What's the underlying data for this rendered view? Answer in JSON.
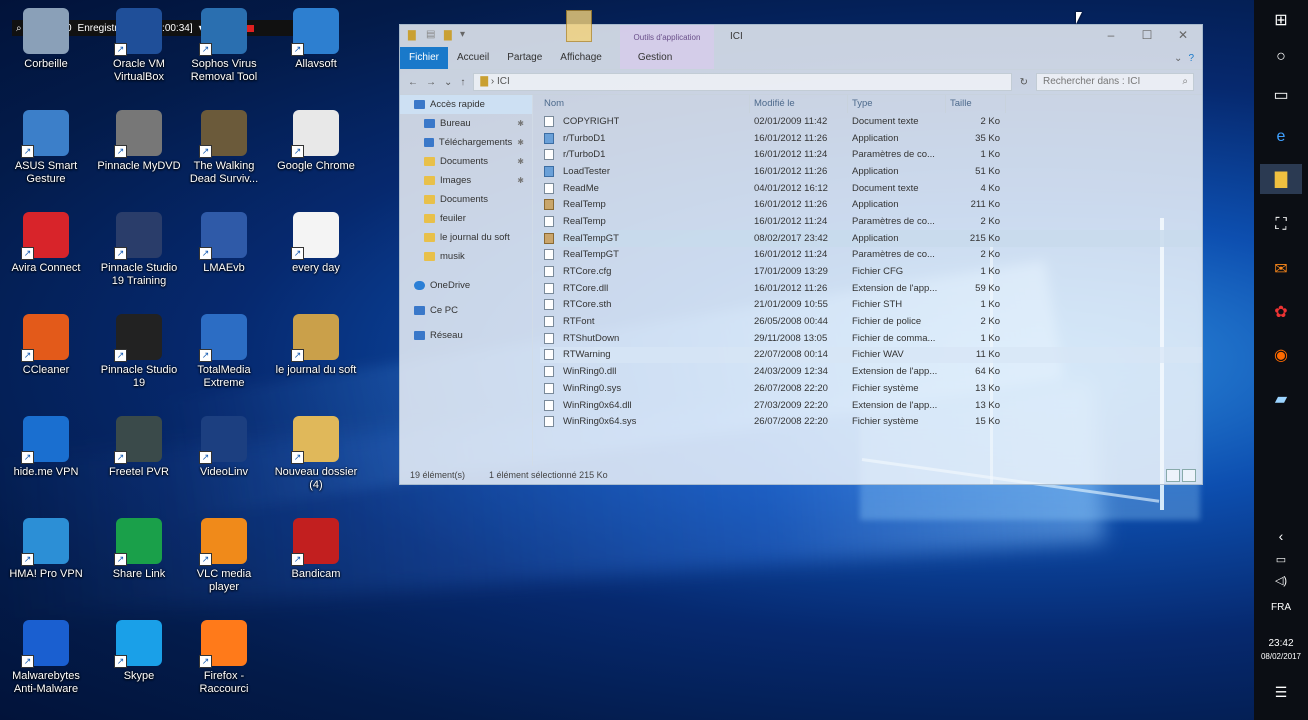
{
  "recorder": {
    "resolution": "1308x720",
    "status": "Enregistrement [00:00:34]"
  },
  "desktop": {
    "icons": [
      {
        "label": "Corbeille"
      },
      {
        "label": "Oracle VM VirtualBox"
      },
      {
        "label": "Sophos Virus Removal Tool"
      },
      {
        "label": "Allavsoft"
      },
      {
        "label": "ASUS Smart Gesture"
      },
      {
        "label": "Pinnacle MyDVD"
      },
      {
        "label": "The Walking Dead Surviv..."
      },
      {
        "label": "Google Chrome"
      },
      {
        "label": "Avira Connect"
      },
      {
        "label": "Pinnacle Studio 19 Training"
      },
      {
        "label": "LMAEvb"
      },
      {
        "label": "every day"
      },
      {
        "label": "CCleaner"
      },
      {
        "label": "Pinnacle Studio 19"
      },
      {
        "label": "TotalMedia Extreme"
      },
      {
        "label": "le journal du soft"
      },
      {
        "label": "hide.me VPN"
      },
      {
        "label": "Freetel PVR"
      },
      {
        "label": "VideoLinv"
      },
      {
        "label": "Nouveau dossier (4)"
      },
      {
        "label": "HMA! Pro VPN"
      },
      {
        "label": "Share Link"
      },
      {
        "label": "VLC media player"
      },
      {
        "label": "Bandicam"
      },
      {
        "label": "Malwarebytes Anti-Malware"
      },
      {
        "label": "Skype"
      },
      {
        "label": "Firefox - Raccourci"
      }
    ]
  },
  "explorer": {
    "title": "ICI",
    "context_tab": "Outils d'application",
    "ribbon_tabs": [
      "Fichier",
      "Accueil",
      "Partage",
      "Affichage",
      "Gestion"
    ],
    "path_folder": "ICI",
    "search_placeholder": "Rechercher dans : ICI",
    "nav": [
      {
        "label": "Accès rapide",
        "pin": ""
      },
      {
        "label": "Bureau",
        "pin": "✱"
      },
      {
        "label": "Téléchargements",
        "pin": "✱"
      },
      {
        "label": "Documents",
        "pin": "✱"
      },
      {
        "label": "Images",
        "pin": "✱"
      },
      {
        "label": "Documents",
        "pin": ""
      },
      {
        "label": "feuiler",
        "pin": ""
      },
      {
        "label": "le journal du soft",
        "pin": ""
      },
      {
        "label": "musik",
        "pin": ""
      },
      {
        "label": "OneDrive",
        "pin": ""
      },
      {
        "label": "Ce PC",
        "pin": ""
      },
      {
        "label": "Réseau",
        "pin": ""
      }
    ],
    "columns": {
      "name": "Nom",
      "date": "Modifié le",
      "type": "Type",
      "size": "Taille"
    },
    "files": [
      {
        "name": "COPYRIGHT",
        "date": "02/01/2009 11:42",
        "type": "Document texte",
        "size": "2 Ko"
      },
      {
        "name": "r/TurboD1",
        "date": "16/01/2012 11:26",
        "type": "Application",
        "size": "35 Ko"
      },
      {
        "name": "r/TurboD1",
        "date": "16/01/2012 11:24",
        "type": "Paramètres de co...",
        "size": "1 Ko"
      },
      {
        "name": "LoadTester",
        "date": "16/01/2012 11:26",
        "type": "Application",
        "size": "51 Ko"
      },
      {
        "name": "ReadMe",
        "date": "04/01/2012 16:12",
        "type": "Document texte",
        "size": "4 Ko"
      },
      {
        "name": "RealTemp",
        "date": "16/01/2012 11:26",
        "type": "Application",
        "size": "211 Ko"
      },
      {
        "name": "RealTemp",
        "date": "16/01/2012 11:24",
        "type": "Paramètres de co...",
        "size": "2 Ko"
      },
      {
        "name": "RealTempGT",
        "date": "08/02/2017 23:42",
        "type": "Application",
        "size": "215 Ko"
      },
      {
        "name": "RealTempGT",
        "date": "16/01/2012 11:24",
        "type": "Paramètres de co...",
        "size": "2 Ko"
      },
      {
        "name": "RTCore.cfg",
        "date": "17/01/2009 13:29",
        "type": "Fichier CFG",
        "size": "1 Ko"
      },
      {
        "name": "RTCore.dll",
        "date": "16/01/2012 11:26",
        "type": "Extension de l'app...",
        "size": "59 Ko"
      },
      {
        "name": "RTCore.sth",
        "date": "21/01/2009 10:55",
        "type": "Fichier STH",
        "size": "1 Ko"
      },
      {
        "name": "RTFont",
        "date": "26/05/2008 00:44",
        "type": "Fichier de police",
        "size": "2 Ko"
      },
      {
        "name": "RTShutDown",
        "date": "29/11/2008 13:05",
        "type": "Fichier de comma...",
        "size": "1 Ko"
      },
      {
        "name": "RTWarning",
        "date": "22/07/2008 00:14",
        "type": "Fichier WAV",
        "size": "11 Ko"
      },
      {
        "name": "WinRing0.dll",
        "date": "24/03/2009 12:34",
        "type": "Extension de l'app...",
        "size": "64 Ko"
      },
      {
        "name": "WinRing0.sys",
        "date": "26/07/2008 22:20",
        "type": "Fichier système",
        "size": "13 Ko"
      },
      {
        "name": "WinRing0x64.dll",
        "date": "27/03/2009 22:20",
        "type": "Extension de l'app...",
        "size": "13 Ko"
      },
      {
        "name": "WinRing0x64.sys",
        "date": "26/07/2008 22:20",
        "type": "Fichier système",
        "size": "15 Ko"
      }
    ],
    "status_count": "19 élément(s)",
    "status_selection": "1 élément sélectionné  215 Ko"
  },
  "taskbar": {
    "language": "FRA",
    "time": "23:42",
    "date": "08/02/2017"
  }
}
